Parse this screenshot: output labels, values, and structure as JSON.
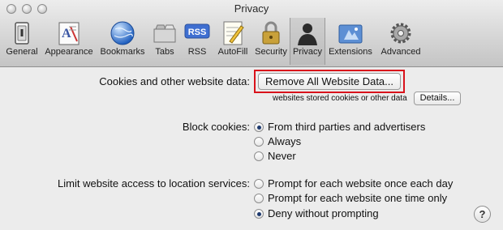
{
  "window": {
    "title": "Privacy"
  },
  "toolbar": {
    "items": [
      {
        "label": "General",
        "icon": "general-icon"
      },
      {
        "label": "Appearance",
        "icon": "appearance-icon"
      },
      {
        "label": "Bookmarks",
        "icon": "bookmarks-icon"
      },
      {
        "label": "Tabs",
        "icon": "tabs-icon"
      },
      {
        "label": "RSS",
        "icon": "rss-icon",
        "badge": "RSS"
      },
      {
        "label": "AutoFill",
        "icon": "autofill-icon"
      },
      {
        "label": "Security",
        "icon": "security-icon"
      },
      {
        "label": "Privacy",
        "icon": "privacy-icon",
        "selected": true
      },
      {
        "label": "Extensions",
        "icon": "extensions-icon"
      },
      {
        "label": "Advanced",
        "icon": "advanced-icon"
      }
    ]
  },
  "cookies": {
    "label": "Cookies and other website data:",
    "remove_button": "Remove All Website Data...",
    "note": "websites stored cookies or other data",
    "details_button": "Details..."
  },
  "block_cookies": {
    "label": "Block cookies:",
    "options": [
      "From third parties and advertisers",
      "Always",
      "Never"
    ],
    "selected": 0
  },
  "location": {
    "label": "Limit website access to location services:",
    "options": [
      "Prompt for each website once each day",
      "Prompt for each website one time only",
      "Deny without prompting"
    ],
    "selected": 2
  },
  "help": {
    "label": "?"
  },
  "colors": {
    "highlight": "#d9121b",
    "radio_dot": "#1e3a6f"
  }
}
